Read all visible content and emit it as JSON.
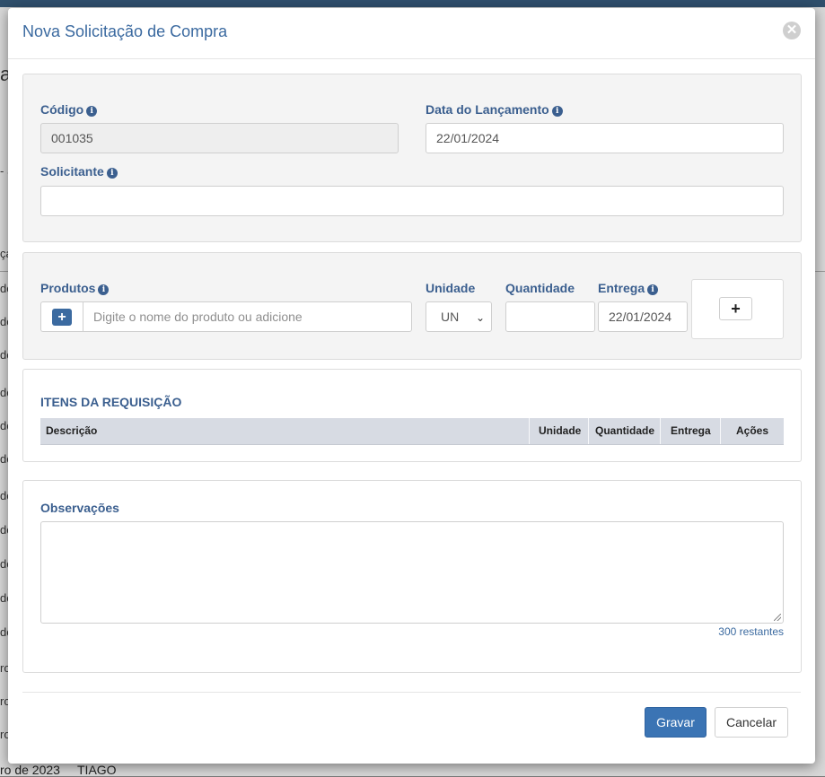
{
  "background": {
    "left_fragments": [
      "a",
      "- S",
      "ça",
      "de",
      "de",
      "de",
      "de",
      "de",
      "de",
      "de",
      "de",
      "de",
      "de",
      "de",
      "ro",
      "ro",
      "ro"
    ],
    "bottom_date": "ro de 2023",
    "bottom_name": "TIAGO"
  },
  "modal": {
    "title": "Nova Solicitação de Compra",
    "close_label": "✕"
  },
  "form": {
    "codigo_label": "Código",
    "codigo_value": "001035",
    "data_lancamento_label": "Data do Lançamento",
    "data_lancamento_value": "22/01/2024",
    "solicitante_label": "Solicitante",
    "solicitante_value": ""
  },
  "produtos": {
    "label": "Produtos",
    "add_button": "+",
    "search_placeholder": "Digite o nome do produto ou adicione",
    "unidade_label": "Unidade",
    "unidade_value": "UN",
    "quantidade_label": "Quantidade",
    "quantidade_value": "",
    "entrega_label": "Entrega",
    "entrega_value": "22/01/2024",
    "add_item_button": "+"
  },
  "itens": {
    "title": "ITENS DA REQUISIÇÃO",
    "columns": [
      "Descrição",
      "Unidade",
      "Quantidade",
      "Entrega",
      "Ações"
    ]
  },
  "observacoes": {
    "label": "Observações",
    "value": "",
    "counter": "300 restantes"
  },
  "footer": {
    "save_label": "Gravar",
    "cancel_label": "Cancelar"
  },
  "icons": {
    "info": "info-circle-icon",
    "close": "close-circle-icon",
    "plus": "plus-icon",
    "chevron": "chevron-down-icon"
  },
  "colors": {
    "accent": "#3b6aa0",
    "label": "#3b5f8f",
    "primary_button": "#3b74b4",
    "table_header": "#d7dbe3"
  }
}
